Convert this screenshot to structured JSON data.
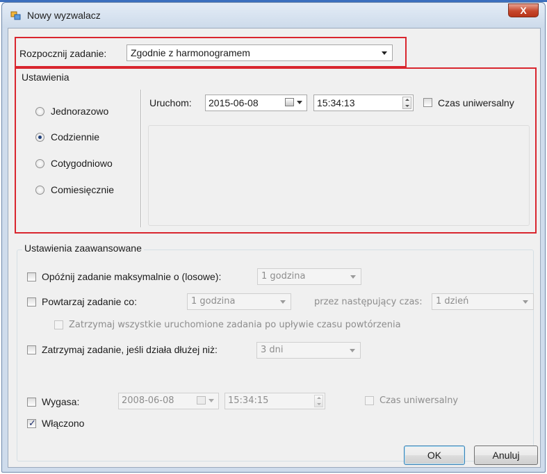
{
  "window": {
    "title": "Nowy wyzwalacz",
    "close_label": "X"
  },
  "start_task": {
    "label": "Rozpocznij zadanie:",
    "value": "Zgodnie z harmonogramem"
  },
  "settings": {
    "group_title": "Ustawienia",
    "radios": [
      {
        "label": "Jednorazowo",
        "checked": false
      },
      {
        "label": "Codziennie",
        "checked": true
      },
      {
        "label": "Cotygodniowo",
        "checked": false
      },
      {
        "label": "Comiesięcznie",
        "checked": false
      }
    ],
    "start_label": "Uruchom:",
    "start_date": "2015-06-08",
    "start_time": "15:34:13",
    "utc_label": "Czas uniwersalny"
  },
  "advanced": {
    "group_title": "Ustawienia zaawansowane",
    "delay_label": "Opóźnij zadanie maksymalnie o (losowe):",
    "delay_value": "1 godzina",
    "repeat_label": "Powtarzaj zadanie co:",
    "repeat_value": "1 godzina",
    "repeat_duration_label": "przez następujący czas:",
    "repeat_duration_value": "1 dzień",
    "stop_all_label": "Zatrzymaj wszystkie uruchomione zadania po upływie czasu powtórzenia",
    "stop_long_label": "Zatrzymaj zadanie, jeśli działa dłużej niż:",
    "stop_long_value": "3 dni",
    "expire_label": "Wygasa:",
    "expire_date": "2008-06-08",
    "expire_time": "15:34:15",
    "expire_utc_label": "Czas uniwersalny",
    "enabled_label": "Włączono",
    "enabled_checked": true
  },
  "buttons": {
    "ok": "OK",
    "cancel": "Anuluj"
  },
  "colors": {
    "highlight": "#d9252e",
    "titlebar": "#cddbeb",
    "dialog_bg": "#f0f0f0"
  }
}
